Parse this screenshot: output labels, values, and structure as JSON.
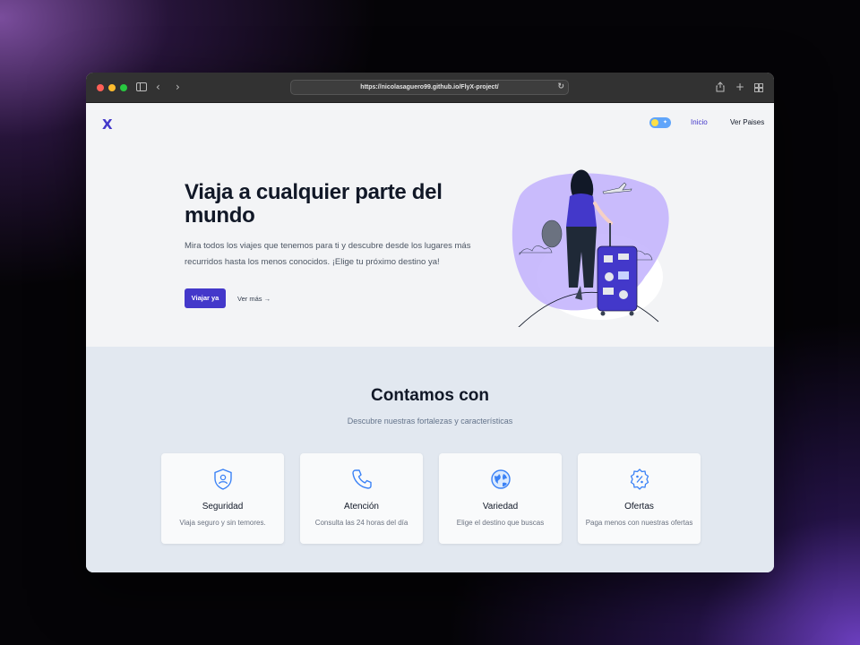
{
  "browser": {
    "url": "https://nicolasaguero99.github.io/FlyX-project/",
    "traffic_lights": [
      "#ff5f57",
      "#febc2e",
      "#28c840"
    ]
  },
  "header": {
    "logo": "X",
    "nav": [
      {
        "label": "Inicio"
      },
      {
        "label": "Ver Paises"
      }
    ]
  },
  "hero": {
    "title": "Viaja a cualquier parte del mundo",
    "description": "Mira todos los viajes que tenemos para ti y descubre desde los lugares más recurridos hasta los menos conocidos. ¡Elige tu próximo destino ya!",
    "primary_button": "Viajar ya",
    "secondary_button": "Ver más →"
  },
  "features": {
    "title": "Contamos con",
    "subtitle": "Descubre nuestras fortalezas y características",
    "cards": [
      {
        "icon": "shield-user-icon",
        "title": "Seguridad",
        "description": "Viaja seguro y sin temores."
      },
      {
        "icon": "phone-icon",
        "title": "Atención",
        "description": "Consulta las 24 horas del día"
      },
      {
        "icon": "globe-icon",
        "title": "Variedad",
        "description": "Elige el destino que buscas"
      },
      {
        "icon": "discount-badge-icon",
        "title": "Ofertas",
        "description": "Paga menos con nuestras ofertas"
      }
    ]
  },
  "colors": {
    "brand": "#4338ca",
    "icon_blue": "#3b82f6",
    "hero_bg": "#f3f4f6",
    "features_bg": "#e2e8f0",
    "illustration_blob": "#c4b5fd"
  }
}
